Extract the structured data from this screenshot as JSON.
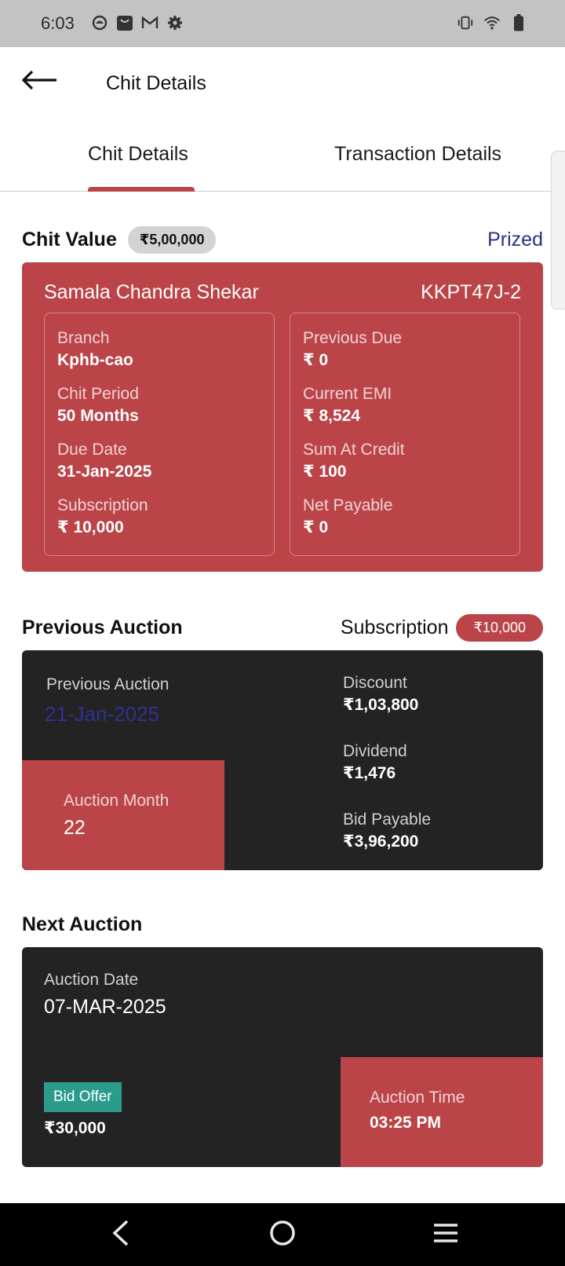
{
  "status_bar": {
    "time": "6:03",
    "left_icons": [
      "app-notification-icon",
      "shopping-bag-icon",
      "gmail-icon",
      "settings-icon"
    ],
    "right_icons": [
      "vibrate-icon",
      "wifi-icon",
      "battery-icon"
    ]
  },
  "app_bar": {
    "title": "Chit Details"
  },
  "tabs": [
    {
      "label": "Chit Details",
      "active": true
    },
    {
      "label": "Transaction Details",
      "active": false
    }
  ],
  "chit_value": {
    "label": "Chit Value",
    "amount": "₹5,00,000",
    "status": "Prized"
  },
  "chit_card": {
    "name": "Samala Chandra Shekar",
    "code": "KKPT47J-2",
    "left": [
      {
        "label": "Branch",
        "value": "Kphb-cao"
      },
      {
        "label": "Chit Period",
        "value": "50 Months"
      },
      {
        "label": "Due Date",
        "value": "31-Jan-2025"
      },
      {
        "label": "Subscription",
        "value": "₹ 10,000"
      }
    ],
    "right": [
      {
        "label": "Previous Due",
        "value": "₹ 0"
      },
      {
        "label": "Current EMI",
        "value": "₹ 8,524"
      },
      {
        "label": "Sum At Credit",
        "value": "₹ 100"
      },
      {
        "label": "Net Payable",
        "value": "₹ 0"
      }
    ]
  },
  "previous_auction": {
    "title": "Previous Auction",
    "subscription_label": "Subscription",
    "subscription_amount": "₹10,000",
    "date_label": "Previous Auction",
    "date_value": "21-Jan-2025",
    "month_label": "Auction Month",
    "month_value": "22",
    "stats": [
      {
        "label": "Discount",
        "value": "₹1,03,800"
      },
      {
        "label": "Dividend",
        "value": "₹1,476"
      },
      {
        "label": "Bid Payable",
        "value": "₹3,96,200"
      }
    ]
  },
  "next_auction": {
    "title": "Next Auction",
    "date_label": "Auction Date",
    "date_value": "07-MAR-2025",
    "bid_label": "Bid Offer",
    "bid_value": "₹30,000",
    "time_label": "Auction Time",
    "time_value": "03:25 PM"
  },
  "colors": {
    "accent_red": "#bb4448",
    "dark_card": "#232323",
    "prized_text": "#2e3180",
    "bid_badge": "#2b9b8b"
  }
}
